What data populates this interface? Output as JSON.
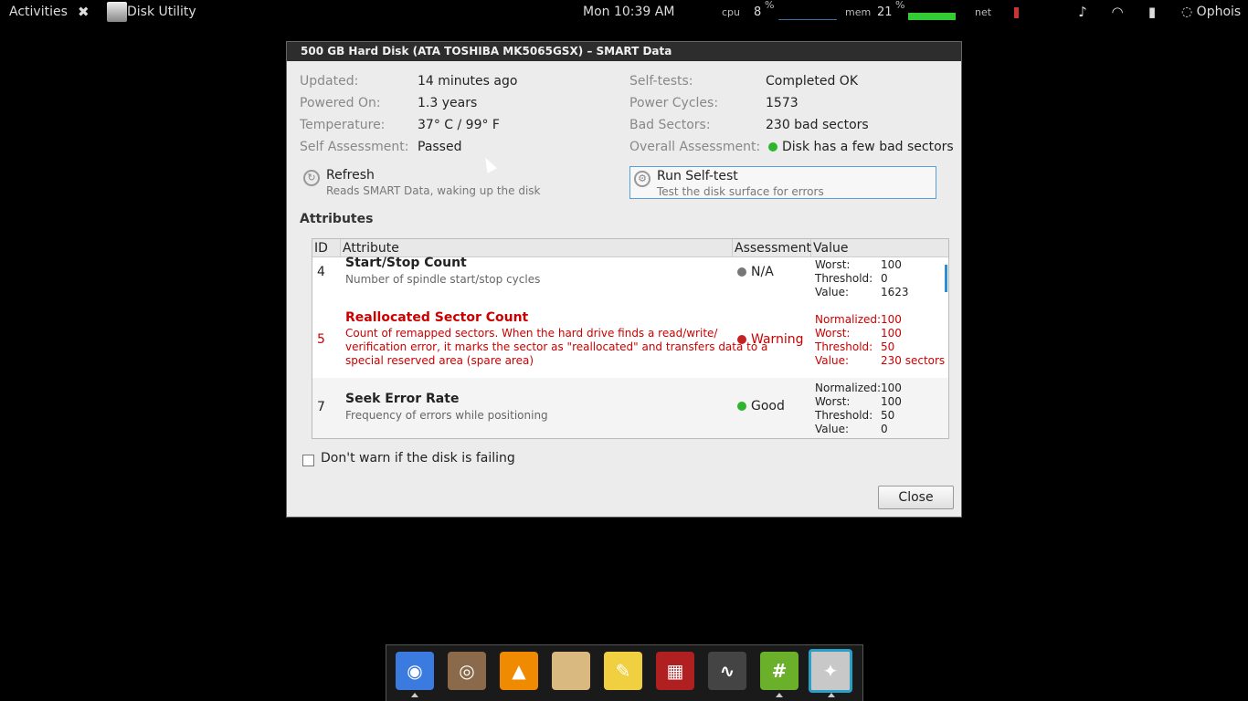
{
  "topbar": {
    "activities": "Activities",
    "close_glyph": "✖",
    "app_name": "Disk Utility",
    "clock": "Mon 10:39 AM",
    "cpu_label": "cpu",
    "cpu_value": "8",
    "cpu_unit": "%",
    "mem_label": "mem",
    "mem_value": "21",
    "mem_unit": "%",
    "net_label": "net",
    "user": "Ophois",
    "icons": [
      "volume-icon",
      "wifi-icon",
      "battery-icon",
      "user-icon"
    ],
    "mem_usage_fraction": 0.21,
    "cpu_usage_fraction": 0.08
  },
  "dialog": {
    "title": "500 GB Hard Disk (ATA TOSHIBA MK5065GSX) – SMART Data",
    "left_info": [
      {
        "label": "Updated:",
        "value": "14 minutes ago"
      },
      {
        "label": "Powered On:",
        "value": "1.3 years"
      },
      {
        "label": "Temperature:",
        "value": "37° C / 99° F"
      },
      {
        "label": "Self Assessment:",
        "value": "Passed"
      }
    ],
    "right_info": [
      {
        "label": "Self-tests:",
        "value": "Completed OK"
      },
      {
        "label": "Power Cycles:",
        "value": "1573"
      },
      {
        "label": "Bad Sectors:",
        "value": "230 bad sectors"
      },
      {
        "label": "Overall Assessment:",
        "value": "Disk has a few bad sectors"
      }
    ],
    "overall_status_color": "#2db52d",
    "refresh": {
      "title": "Refresh",
      "subtitle": "Reads SMART Data, waking up the disk"
    },
    "selftest": {
      "title": "Run Self-test",
      "subtitle": "Test the disk surface for errors"
    },
    "attributes_heading": "Attributes",
    "table": {
      "headers": [
        "ID",
        "Attribute",
        "Assessment",
        "Value"
      ],
      "rows": [
        {
          "id": "4",
          "name": "Start/Stop Count",
          "description": [
            "Number of spindle start/stop cycles"
          ],
          "assessment": "N/A",
          "status": "gray",
          "values": [
            {
              "k": "Worst:",
              "v": "100"
            },
            {
              "k": "Threshold:",
              "v": "0"
            },
            {
              "k": "Value:",
              "v": "1623"
            }
          ]
        },
        {
          "id": "5",
          "name": "Reallocated Sector Count",
          "description": [
            "Count of remapped sectors. When the hard drive finds a read/write/",
            "verification error, it marks the sector as \"reallocated\" and transfers data to a",
            "special reserved area (spare area)"
          ],
          "assessment": "Warning",
          "status": "red",
          "values": [
            {
              "k": "Normalized:",
              "v": "100"
            },
            {
              "k": "Worst:",
              "v": "100"
            },
            {
              "k": "Threshold:",
              "v": "50"
            },
            {
              "k": "Value:",
              "v": "230 sectors"
            }
          ]
        },
        {
          "id": "7",
          "name": "Seek Error Rate",
          "description": [
            "Frequency of errors while positioning"
          ],
          "assessment": "Good",
          "status": "green",
          "values": [
            {
              "k": "Normalized:",
              "v": "100"
            },
            {
              "k": "Worst:",
              "v": "100"
            },
            {
              "k": "Threshold:",
              "v": "50"
            },
            {
              "k": "Value:",
              "v": "0"
            }
          ]
        }
      ]
    },
    "dont_warn_label": "Don't warn if the disk is failing",
    "dont_warn_checked": false,
    "close_label": "Close"
  },
  "dock": {
    "items": [
      {
        "name": "chrome-icon",
        "color": "#3b7be0",
        "glyph": "◉"
      },
      {
        "name": "speaker-icon",
        "color": "#8a6a4a",
        "glyph": "◎"
      },
      {
        "name": "vlc-icon",
        "color": "#f08a00",
        "glyph": "▲"
      },
      {
        "name": "folder-icon",
        "color": "#d9b980",
        "glyph": ""
      },
      {
        "name": "notes-icon",
        "color": "#f0d040",
        "glyph": "✎"
      },
      {
        "name": "terminal-icon",
        "color": "#b02020",
        "glyph": "▦"
      },
      {
        "name": "system-monitor-icon",
        "color": "#444",
        "glyph": "∿"
      },
      {
        "name": "xchat-icon",
        "color": "#6ab02a",
        "glyph": "#"
      },
      {
        "name": "disk-utility-icon",
        "color": "#c8c8c8",
        "glyph": "✦",
        "active": true
      }
    ]
  }
}
